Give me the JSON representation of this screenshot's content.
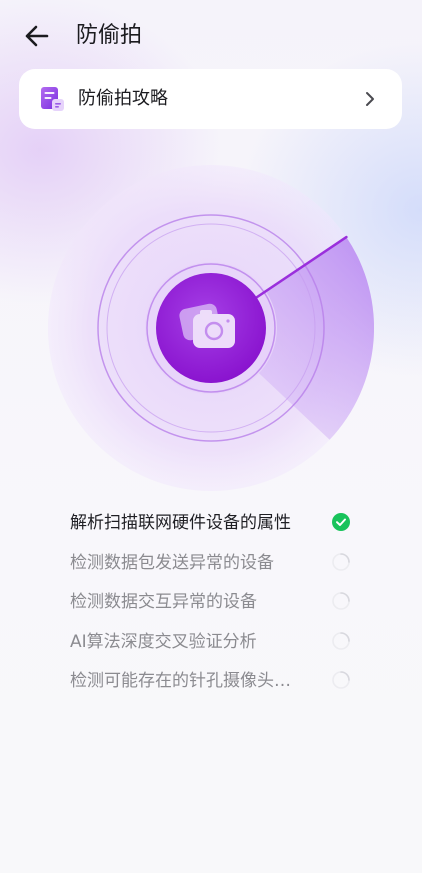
{
  "header": {
    "title": "防偷拍",
    "back_icon": "arrow-left-icon"
  },
  "guide": {
    "label": "防偷拍攻略",
    "icon": "document-guide-icon",
    "chevron_icon": "chevron-right-icon"
  },
  "scanner": {
    "center_icon": "camera-icon"
  },
  "checklist": [
    {
      "label": "解析扫描联网硬件设备的属性",
      "status": "done"
    },
    {
      "label": "检测数据包发送异常的设备",
      "status": "pending"
    },
    {
      "label": "检测数据交互异常的设备",
      "status": "pending"
    },
    {
      "label": "AI算法深度交叉验证分析",
      "status": "pending"
    },
    {
      "label": "检测可能存在的针孔摄像头…",
      "status": "pending"
    }
  ],
  "colors": {
    "accent": "#9b1fd9",
    "success": "#18c35b",
    "text_primary": "#1f1f24",
    "text_secondary": "#8b8b90"
  }
}
